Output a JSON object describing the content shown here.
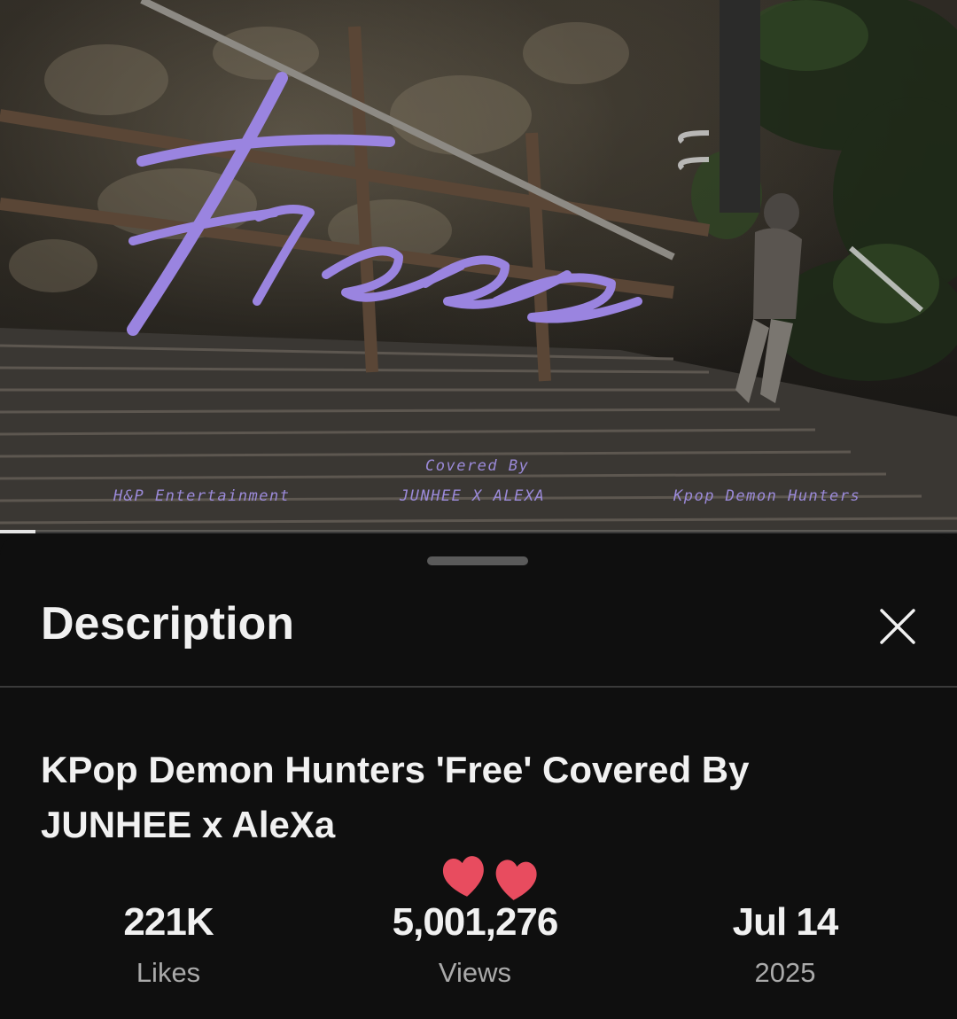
{
  "video": {
    "overlay_title": "Free",
    "credits": {
      "left": "H&P Entertainment",
      "center_top": "Covered By",
      "center": "JUNHEE X ALEXA",
      "right": "Kpop Demon Hunters"
    },
    "progress": 0.037
  },
  "sheet": {
    "heading": "Description",
    "close_icon": "close-icon",
    "title": "KPop Demon Hunters 'Free' Covered By JUNHEE x AleXa",
    "stats": {
      "likes": {
        "value": "221K",
        "label": "Likes"
      },
      "views": {
        "value": "5,001,276",
        "label": "Views"
      },
      "date": {
        "value": "Jul 14",
        "label": "2025"
      }
    },
    "decoration": "two-hearts-icon"
  },
  "colors": {
    "accent_purple": "#9b8ad9",
    "background": "#0f0f0f",
    "text_primary": "#f1f1f1",
    "text_secondary": "#aaaaaa",
    "heart": "#e84c5f"
  }
}
